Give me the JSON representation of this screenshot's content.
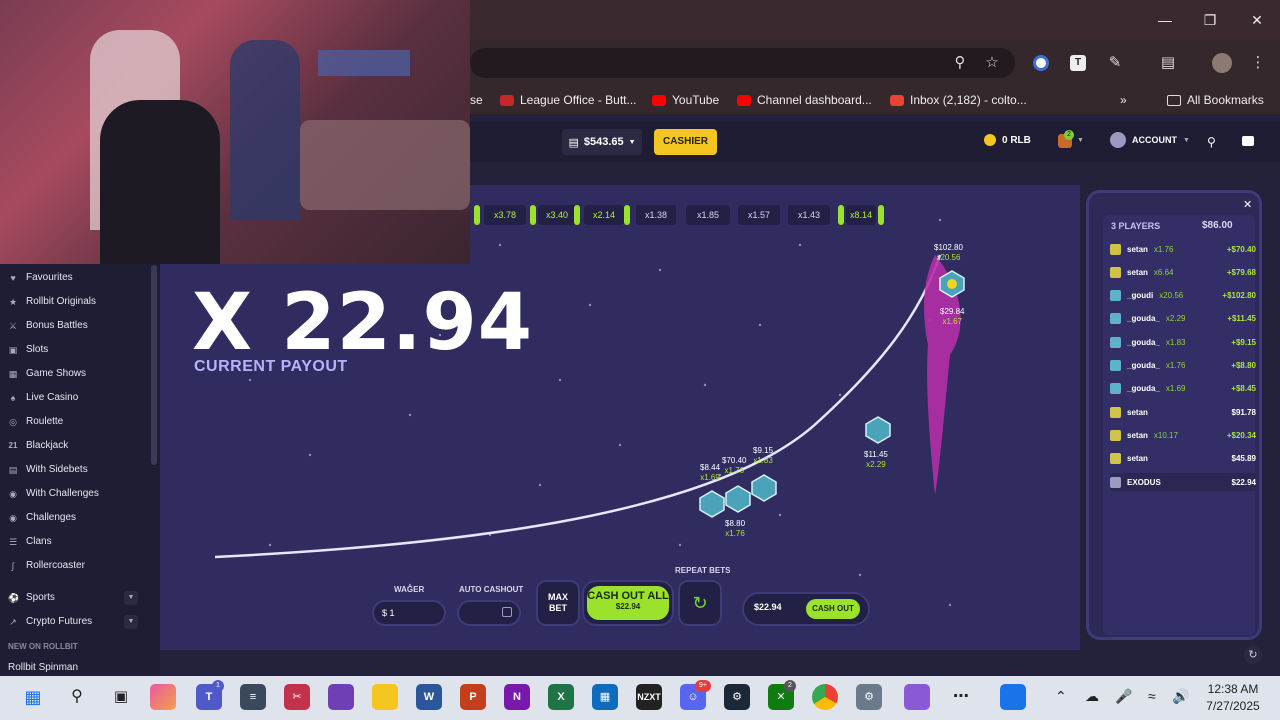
{
  "bookmarks": {
    "items": [
      {
        "label": "se"
      },
      {
        "label": "League Office - Butt...",
        "color": "#c62828"
      },
      {
        "label": "YouTube",
        "color": "#ff0000"
      },
      {
        "label": "Channel dashboard...",
        "color": "#ff0000"
      },
      {
        "label": "Inbox (2,182) - colto...",
        "color": "#ea4335"
      }
    ],
    "all_bookmarks": "All Bookmarks"
  },
  "header": {
    "balance": "$543.65",
    "cashier": "CASHIER",
    "rlb": "0 RLB",
    "notif_count": "2",
    "account": "ACCOUNT"
  },
  "sidebar": {
    "items": [
      {
        "label": "Favourites",
        "icon": "heart-icon"
      },
      {
        "label": "Rollbit Originals",
        "icon": "star-icon"
      },
      {
        "label": "Bonus Battles",
        "icon": "sword-icon"
      },
      {
        "label": "Slots",
        "icon": "slot-icon"
      },
      {
        "label": "Game Shows",
        "icon": "tv-icon"
      },
      {
        "label": "Live Casino",
        "icon": "cards-icon"
      },
      {
        "label": "Roulette",
        "icon": "roulette-icon"
      },
      {
        "label": "Blackjack",
        "icon": "21-icon"
      },
      {
        "label": "With Sidebets",
        "icon": "sidebet-icon"
      },
      {
        "label": "With Challenges",
        "icon": "target-icon"
      },
      {
        "label": "Challenges",
        "icon": "target-icon"
      },
      {
        "label": "Clans",
        "icon": "clan-icon"
      },
      {
        "label": "Rollercoaster",
        "icon": "coaster-icon"
      },
      {
        "label": "Sports",
        "icon": "ball-icon"
      },
      {
        "label": "Crypto Futures",
        "icon": "futures-icon"
      }
    ],
    "new_heading": "NEW ON ROLLBIT",
    "new_item": "Rollbit Spinman"
  },
  "game": {
    "history": [
      "x3.78",
      "x3.40",
      "x2.14",
      "x1.38",
      "x1.85",
      "x1.57",
      "x1.43",
      "x8.14"
    ],
    "history_green": [
      true,
      true,
      true,
      false,
      false,
      false,
      false,
      true
    ],
    "payout": "X 22.94",
    "payout_label": "CURRENT PAYOUT",
    "plane_tags": [
      {
        "amt": "$102.80",
        "mult": "x20.56"
      },
      {
        "amt": "$29.84",
        "mult": "x1.67"
      },
      {
        "amt": "$11.45",
        "mult": "x2.29"
      },
      {
        "amt": "$9.15",
        "mult": "x1.83"
      },
      {
        "amt": "$70.40",
        "mult": "x1.76"
      },
      {
        "amt": "$8.44",
        "mult": "x1.69"
      },
      {
        "amt": "$8.80",
        "mult": "x1.76"
      }
    ],
    "controls": {
      "wager_label": "WAGER",
      "wager_value": "$ 1",
      "auto_cashout_label": "AUTO CASHOUT",
      "repeat_bets_label": "REPEAT BETS",
      "max_bet": "MAX BET",
      "cash_out_all": "CASH OUT ALL",
      "cash_out_all_amount": "$22.94",
      "cashout_amount": "$22.94",
      "cash_out": "CASH OUT"
    }
  },
  "players": {
    "title": "3 PLAYERS",
    "total": "$86.00",
    "rows": [
      {
        "name": "setan",
        "mult": "x1.76",
        "val": "+$70.40",
        "win": true,
        "color": "#d3c24a"
      },
      {
        "name": "setan",
        "mult": "x6.64",
        "val": "+$79.68",
        "win": true,
        "color": "#d3c24a"
      },
      {
        "name": "_goudi",
        "mult": "x20.56",
        "val": "+$102.80",
        "win": true,
        "color": "#5fb3c9"
      },
      {
        "name": "_gouda_",
        "mult": "x2.29",
        "val": "+$11.45",
        "win": true,
        "color": "#5fb3c9"
      },
      {
        "name": "_gouda_",
        "mult": "x1.83",
        "val": "+$9.15",
        "win": true,
        "color": "#5fb3c9"
      },
      {
        "name": "_gouda_",
        "mult": "x1.76",
        "val": "+$8.80",
        "win": true,
        "color": "#5fb3c9"
      },
      {
        "name": "_gouda_",
        "mult": "x1.69",
        "val": "+$8.45",
        "win": true,
        "color": "#5fb3c9"
      },
      {
        "name": "setan",
        "mult": "",
        "val": "$91.78",
        "win": false,
        "color": "#d3c24a"
      },
      {
        "name": "setan",
        "mult": "x10.17",
        "val": "+$20.34",
        "win": true,
        "color": "#d3c24a"
      },
      {
        "name": "setan",
        "mult": "",
        "val": "$45.89",
        "win": false,
        "color": "#d3c24a"
      },
      {
        "name": "EXODUS",
        "mult": "",
        "val": "$22.94",
        "win": false,
        "color": "#9a9ac2"
      }
    ]
  },
  "taskbar": {
    "time": "12:38 AM",
    "date": "7/27/2025",
    "teams_badge": "1",
    "discord_badge": "9+",
    "xbox_badge": "2",
    "nzxt_label": "NZXT"
  },
  "colors": {
    "accent_green": "#9be22c",
    "cashier_yellow": "#f3c622",
    "game_bg": "#302c5f"
  }
}
